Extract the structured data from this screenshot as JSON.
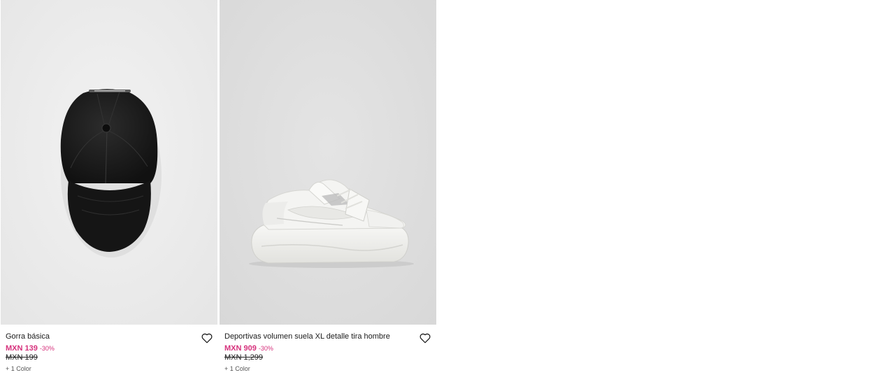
{
  "products": [
    {
      "name": "Gorra básica",
      "price": "MXN 139",
      "discount": "-30%",
      "original_price": "MXN 199",
      "colors": "+ 1 Color",
      "image_icon": "black-cap-image",
      "wishlist_icon": "heart-outline-icon"
    },
    {
      "name": "Deportivas volumen suela XL detalle tira hombre",
      "price": "MXN 909",
      "discount": "-30%",
      "original_price": "MXN 1,299",
      "colors": "+ 1 Color",
      "image_icon": "white-sneaker-image",
      "wishlist_icon": "heart-outline-icon"
    }
  ],
  "colors": {
    "sale_price": "#d6317c",
    "text": "#1a1a1a",
    "image_background_cap": "#ececec",
    "image_background_sneaker": "#dedede"
  }
}
